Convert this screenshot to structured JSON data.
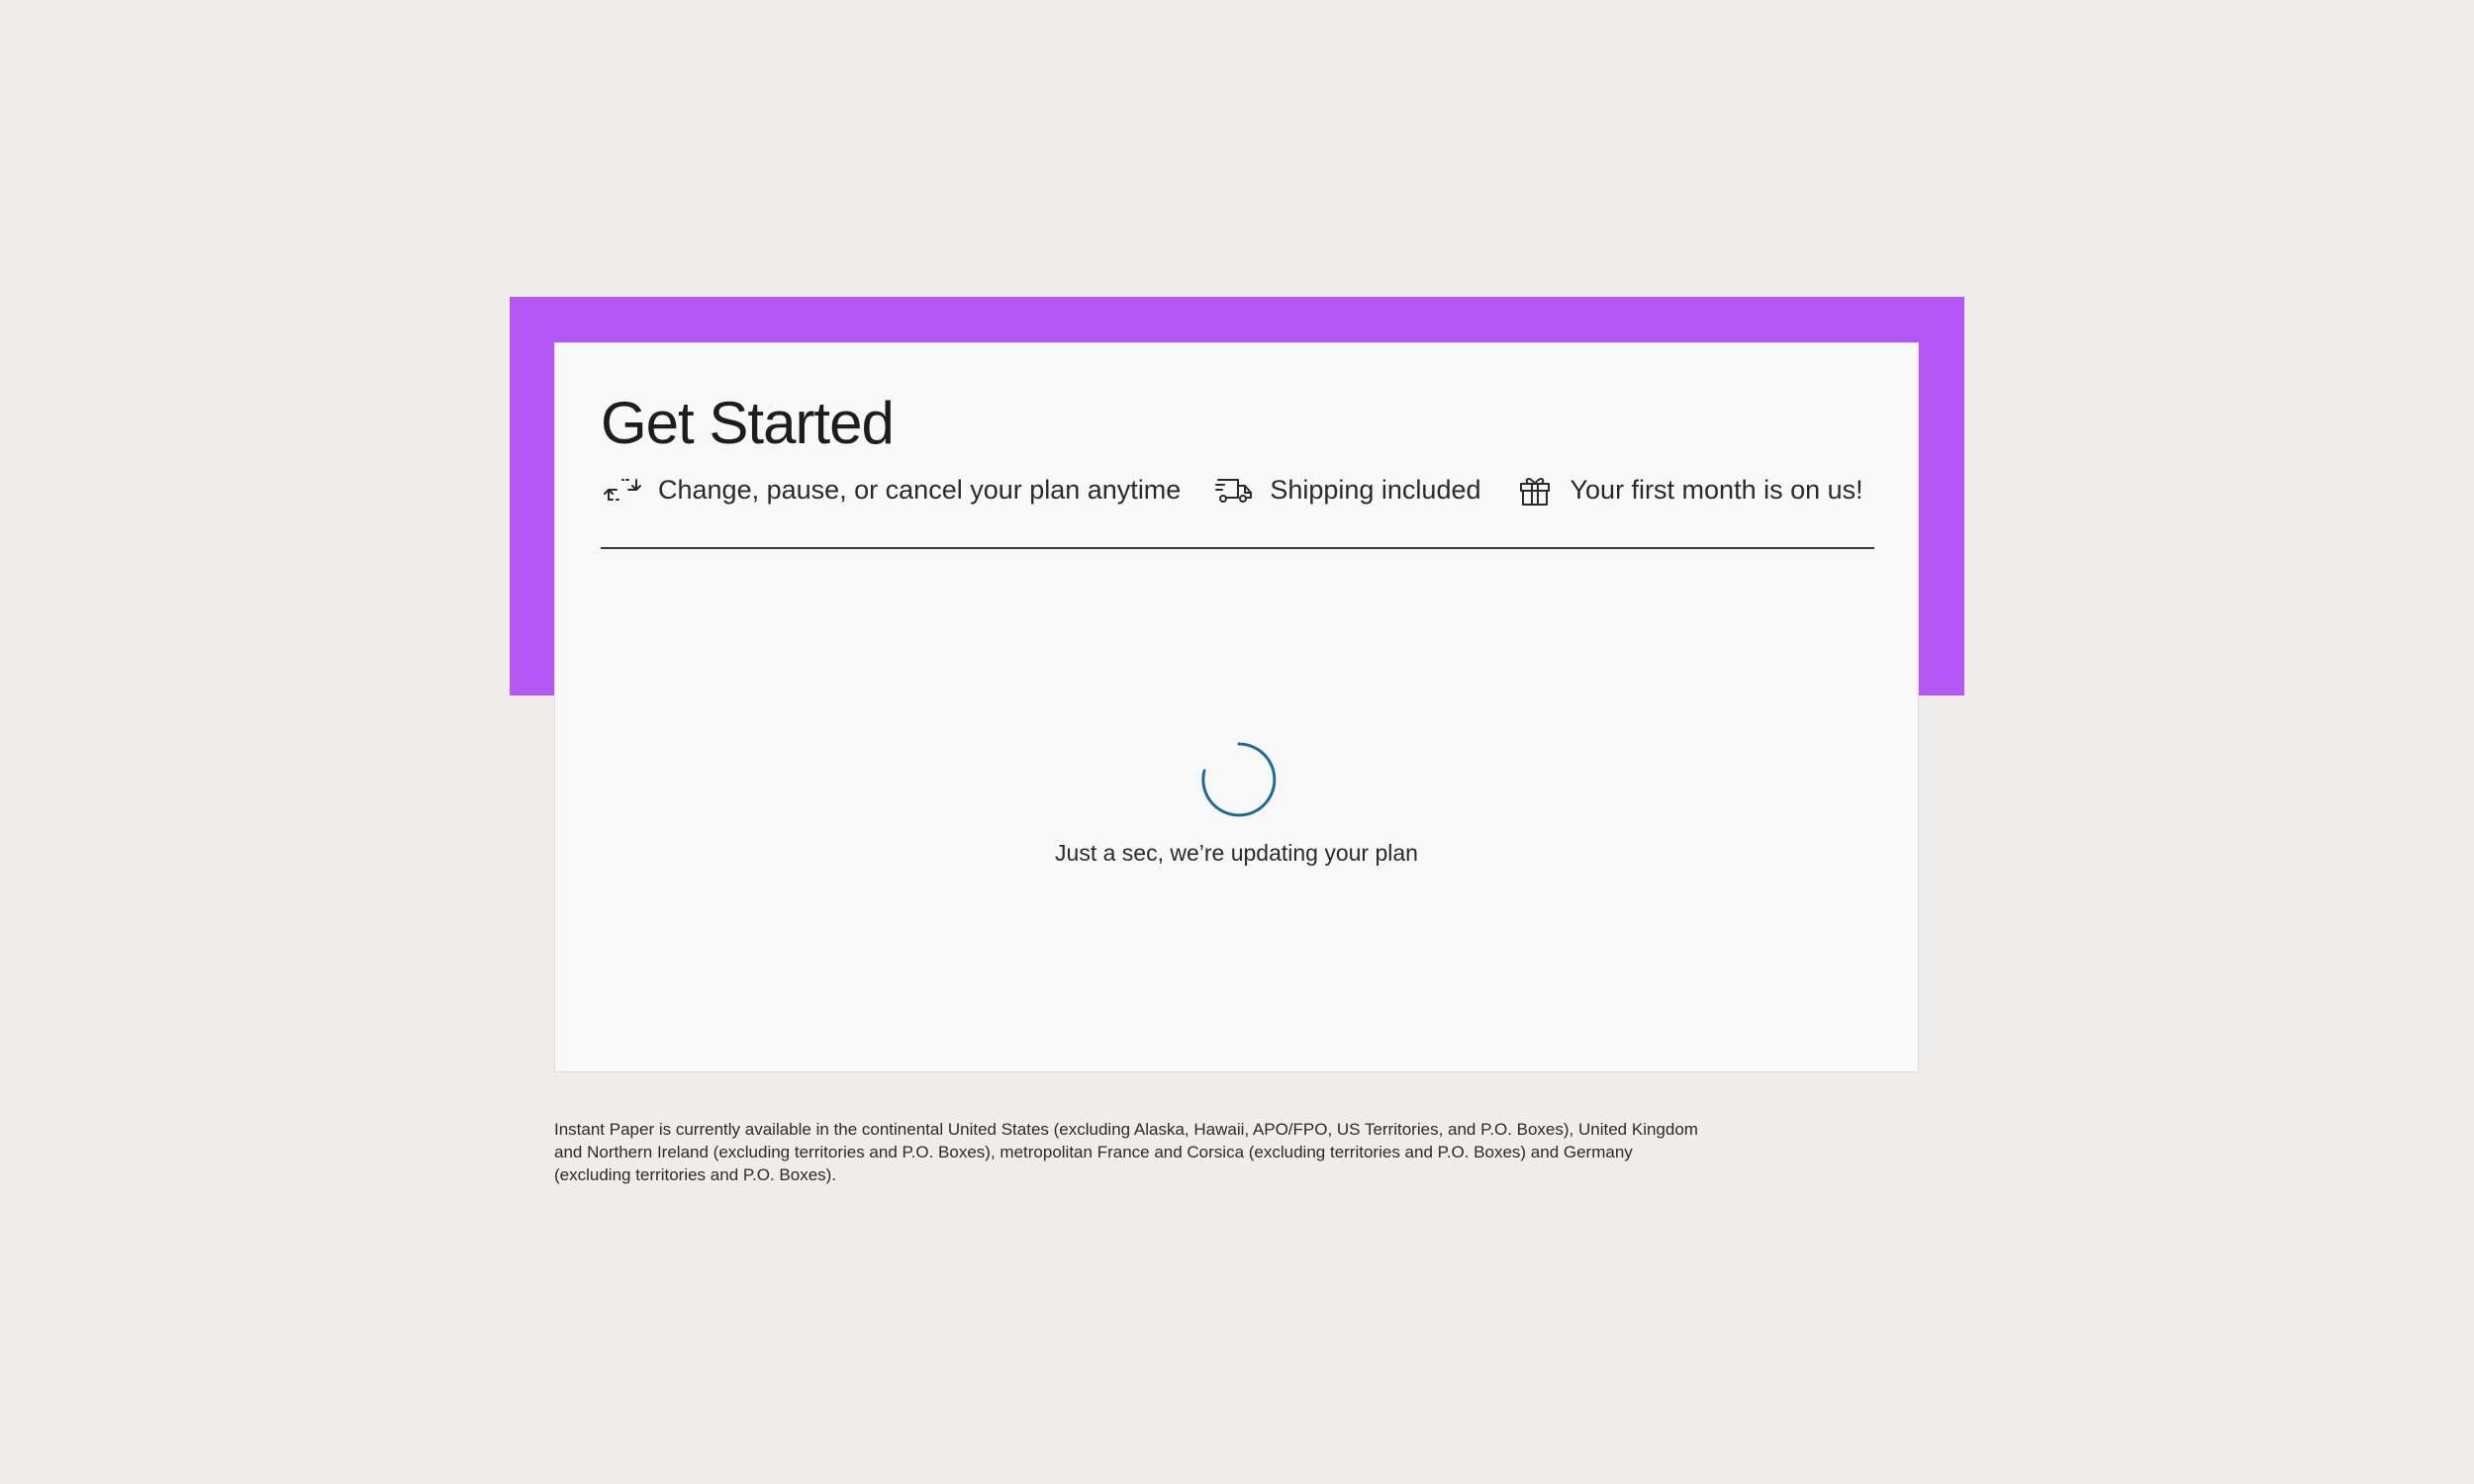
{
  "page": {
    "title": "Get Started",
    "accent_color": "#b457f5",
    "spinner_color": "#1f6b96"
  },
  "features": [
    {
      "icon": "repeat-arrows-icon",
      "label": "Change, pause, or cancel your plan anytime"
    },
    {
      "icon": "delivery-truck-icon",
      "label": "Shipping included"
    },
    {
      "icon": "gift-icon",
      "label": "Your first month is on us!"
    }
  ],
  "loading": {
    "message": "Just a sec, we’re updating your plan"
  },
  "footer": {
    "disclaimer": "Instant Paper is currently available in the continental United States (excluding Alaska, Hawaii, APO/FPO, US Territories, and P.O. Boxes), United Kingdom and Northern Ireland (excluding territories and P.O. Boxes), metropolitan France and Corsica (excluding territories and P.O. Boxes) and Germany (excluding territories and P.O. Boxes)."
  }
}
